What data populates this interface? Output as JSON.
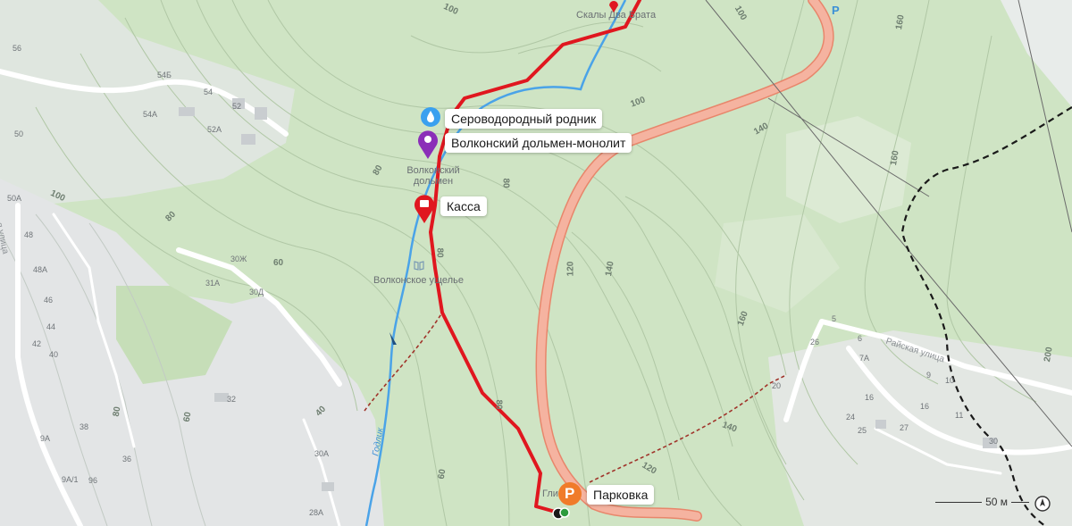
{
  "colors": {
    "forest": "#cfe4c4",
    "forest_dark": "#bfdab1",
    "urban": "#e3e5e6",
    "route": "#e0171f",
    "road_fill": "#f5b3a0",
    "road_casing": "#e8866b",
    "stream": "#4aa3e8",
    "trail": "#a0332a",
    "boundary": "#1a1a1a"
  },
  "pois": {
    "spring": "Сероводородный родник",
    "dolmen": "Волконский дольмен-монолит",
    "dolmen_sub": "Волконский дольмен",
    "kassa": "Касса",
    "parking": "Парковка",
    "rocks": "Скалы Два Брата",
    "gorge": "Волконское ущелье",
    "glin": "Гли",
    "parking_glyph": "P",
    "map_parking_glyph": "P"
  },
  "streets": {
    "raiskaya": "Райская улица",
    "vertical": "я улица",
    "stream_name": "Годлик"
  },
  "contours": [
    "100",
    "100",
    "100",
    "100",
    "140",
    "160",
    "160",
    "160",
    "140",
    "140",
    "120",
    "120",
    "80",
    "80",
    "80",
    "80",
    "80",
    "80",
    "60",
    "60",
    "60",
    "60",
    "40",
    "120",
    "200"
  ],
  "houses": [
    "56",
    "54Б",
    "54",
    "52",
    "54А",
    "52А",
    "50",
    "50А",
    "48",
    "48А",
    "46",
    "44",
    "42",
    "40",
    "30Ж",
    "31А",
    "30Д",
    "32",
    "38",
    "36",
    "9А",
    "9А/1",
    "96",
    "30А",
    "28А",
    "5",
    "26",
    "6",
    "7А",
    "9",
    "10",
    "16",
    "16",
    "11",
    "24",
    "27",
    "25",
    "30",
    "20"
  ],
  "scale": {
    "label": "50 м"
  }
}
